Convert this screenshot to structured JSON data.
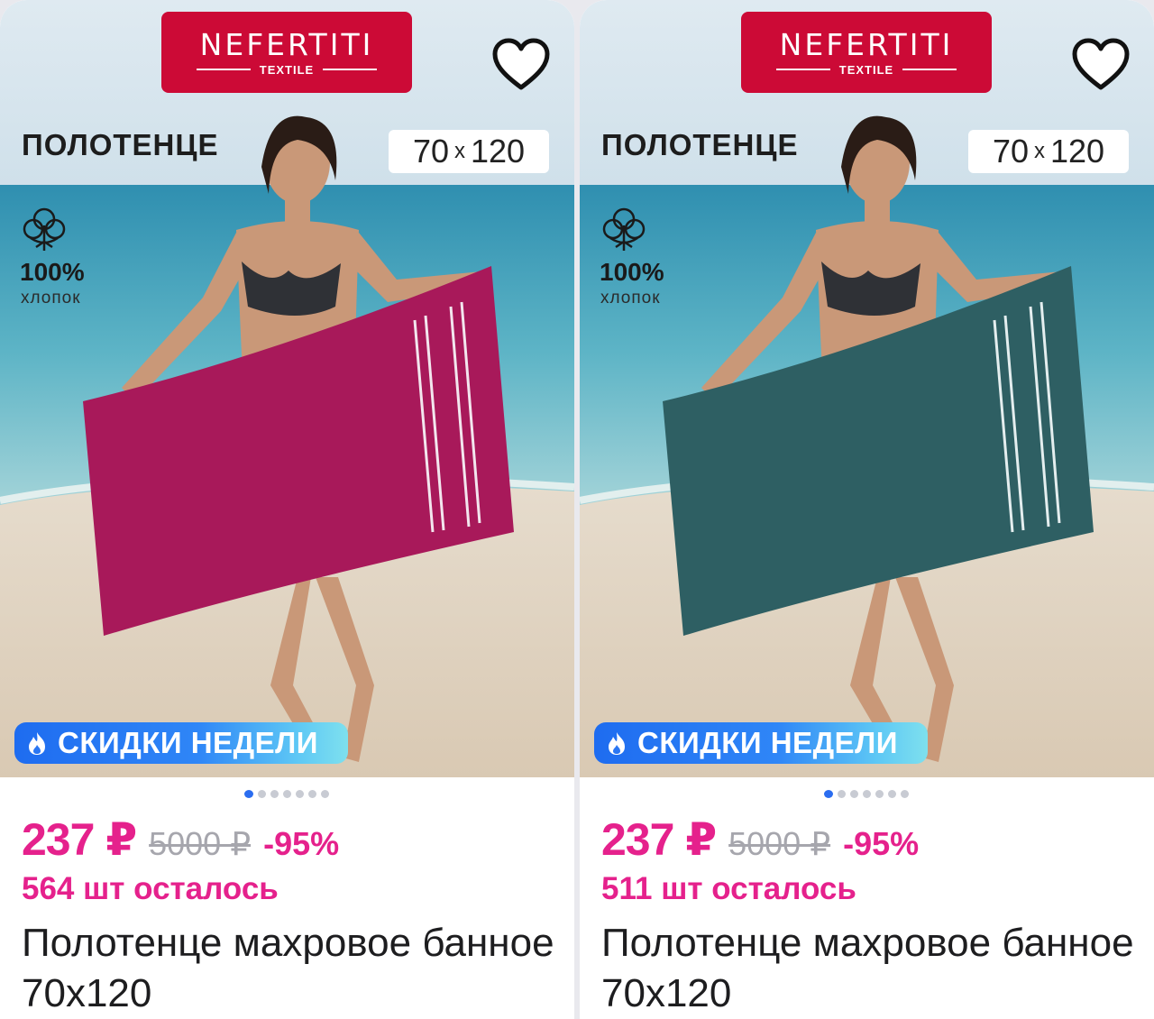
{
  "cards": [
    {
      "brand": {
        "name": "NEFERTITI",
        "sub": "TEXTILE"
      },
      "image_title": "ПОЛОТЕНЦЕ",
      "size": {
        "w": "70",
        "x": "x",
        "h": "120"
      },
      "cotton": {
        "pct": "100%",
        "label": "хлопок"
      },
      "promo": "СКИДКИ НЕДЕЛИ",
      "price": "237 ₽",
      "old_price": "5000 ₽",
      "discount": "-95%",
      "stock": "564 шт осталось",
      "name": "Полотенце махровое банное 70х120",
      "towel_color": "#a8195a",
      "carousel": {
        "count": 7,
        "active": 1
      }
    },
    {
      "brand": {
        "name": "NEFERTITI",
        "sub": "TEXTILE"
      },
      "image_title": "ПОЛОТЕНЦЕ",
      "size": {
        "w": "70",
        "x": "x",
        "h": "120"
      },
      "cotton": {
        "pct": "100%",
        "label": "хлопок"
      },
      "promo": "СКИДКИ НЕДЕЛИ",
      "price": "237 ₽",
      "old_price": "5000 ₽",
      "discount": "-95%",
      "stock": "511 шт осталось",
      "name": "Полотенце махровое банное 70х120",
      "towel_color": "#2e5f63",
      "carousel": {
        "count": 7,
        "active": 1
      }
    }
  ],
  "colors": {
    "accent": "#e5218c",
    "brand_red": "#cc0a36",
    "promo_blue": "#1e6cf0"
  },
  "icons": [
    "heart-outline-icon",
    "cotton-icon",
    "flame-icon"
  ]
}
